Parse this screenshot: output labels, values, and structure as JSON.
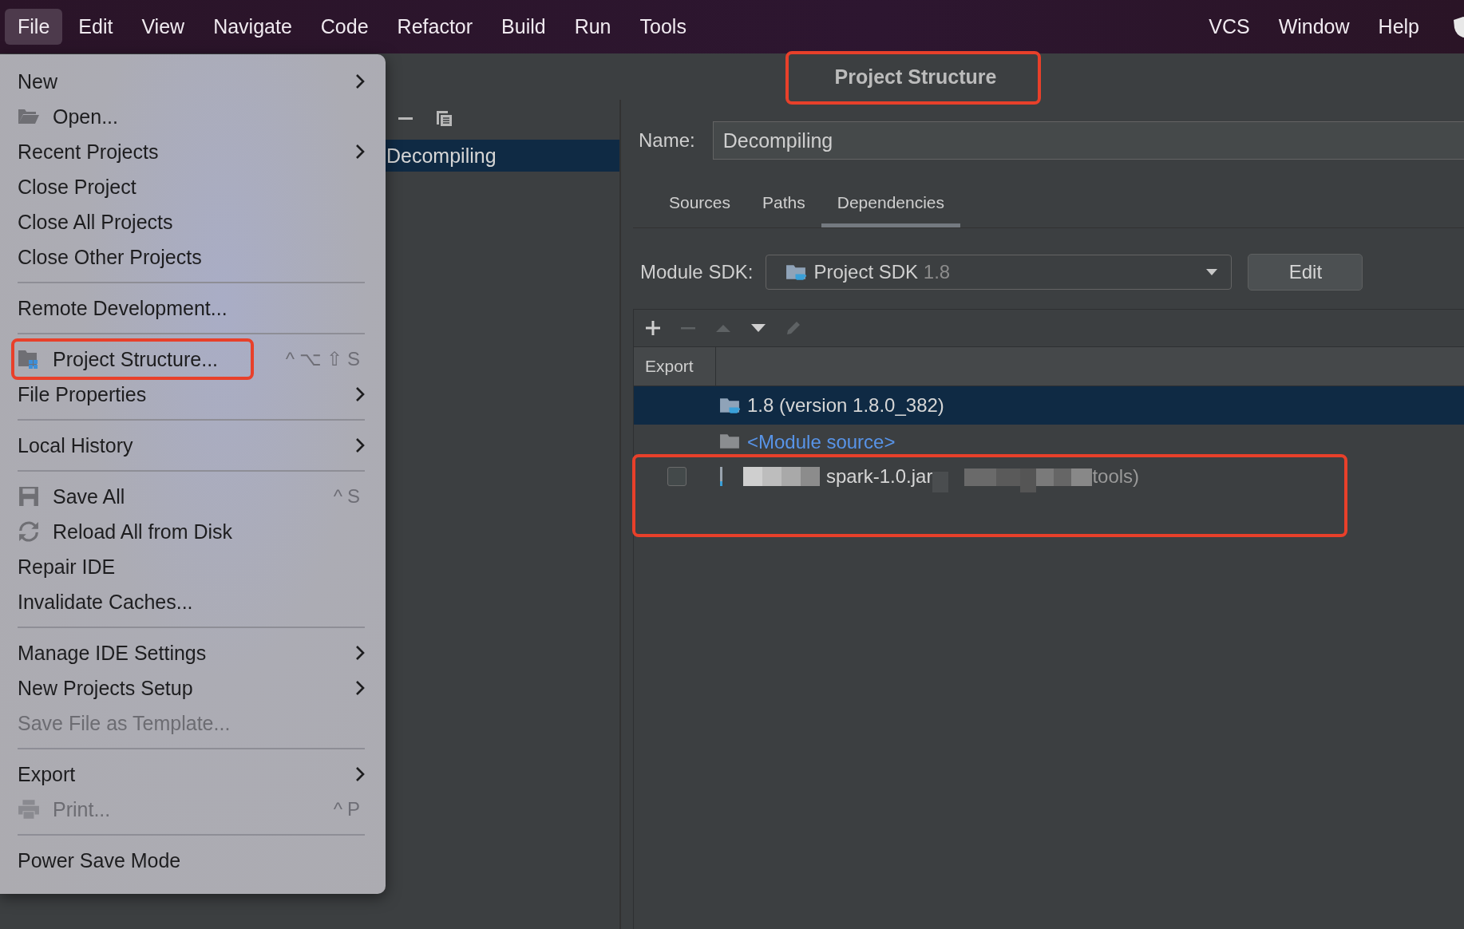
{
  "menu_bar": {
    "items": [
      {
        "label": "File",
        "selected": true
      },
      {
        "label": "Edit",
        "selected": false
      },
      {
        "label": "View",
        "selected": false
      },
      {
        "label": "Navigate",
        "selected": false
      },
      {
        "label": "Code",
        "selected": false
      },
      {
        "label": "Refactor",
        "selected": false
      },
      {
        "label": "Build",
        "selected": false
      },
      {
        "label": "Run",
        "selected": false
      },
      {
        "label": "Tools",
        "selected": false
      }
    ],
    "right_items": [
      {
        "label": "VCS",
        "selected": false
      },
      {
        "label": "Window",
        "selected": false
      },
      {
        "label": "Help",
        "selected": false
      }
    ]
  },
  "file_menu": {
    "items": [
      {
        "kind": "item",
        "label": "New",
        "submenu": true,
        "disabled": false
      },
      {
        "kind": "item",
        "label": "Open...",
        "icon": true,
        "disabled": false
      },
      {
        "kind": "item",
        "label": "Recent Projects",
        "submenu": true,
        "disabled": false
      },
      {
        "kind": "item",
        "label": "Close Project",
        "disabled": false
      },
      {
        "kind": "item",
        "label": "Close All Projects",
        "disabled": false
      },
      {
        "kind": "item",
        "label": "Close Other Projects",
        "disabled": false
      },
      {
        "kind": "separator"
      },
      {
        "kind": "item",
        "label": "Remote Development...",
        "disabled": false
      },
      {
        "kind": "separator"
      },
      {
        "kind": "item",
        "label": "Project Structure...",
        "icon": true,
        "shortcut": "^⌥⇧S",
        "disabled": false,
        "annotated": true
      },
      {
        "kind": "item",
        "label": "File Properties",
        "submenu": true,
        "disabled": false
      },
      {
        "kind": "separator"
      },
      {
        "kind": "item",
        "label": "Local History",
        "submenu": true,
        "disabled": false
      },
      {
        "kind": "separator"
      },
      {
        "kind": "item",
        "label": "Save All",
        "icon": true,
        "shortcut": "^S",
        "disabled": false
      },
      {
        "kind": "item",
        "label": "Reload All from Disk",
        "icon": true,
        "disabled": false
      },
      {
        "kind": "item",
        "label": "Repair IDE",
        "disabled": false
      },
      {
        "kind": "item",
        "label": "Invalidate Caches...",
        "disabled": false
      },
      {
        "kind": "separator"
      },
      {
        "kind": "item",
        "label": "Manage IDE Settings",
        "submenu": true,
        "disabled": false
      },
      {
        "kind": "item",
        "label": "New Projects Setup",
        "submenu": true,
        "disabled": false
      },
      {
        "kind": "item",
        "label": "Save File as Template...",
        "disabled": true
      },
      {
        "kind": "separator"
      },
      {
        "kind": "item",
        "label": "Export",
        "submenu": true,
        "disabled": false
      },
      {
        "kind": "item",
        "label": "Print...",
        "icon": true,
        "shortcut": "^P",
        "disabled": true
      },
      {
        "kind": "separator"
      },
      {
        "kind": "item",
        "label": "Power Save Mode",
        "disabled": false
      }
    ]
  },
  "dialog": {
    "title": "Project Structure",
    "title_annotated": true,
    "modules": [
      {
        "label": "Decompiling",
        "selected": true
      }
    ],
    "name_label": "Name:",
    "name_value": "Decompiling",
    "tabs": [
      {
        "label": "Sources",
        "selected": false
      },
      {
        "label": "Paths",
        "selected": false
      },
      {
        "label": "Dependencies",
        "selected": true
      }
    ],
    "module_sdk_label": "Module SDK:",
    "module_sdk_value": "Project SDK",
    "module_sdk_version": "1.8",
    "edit_button": "Edit",
    "dependency_toolbar": [
      {
        "disabled": false
      },
      {
        "disabled": true
      },
      {
        "disabled": true
      },
      {
        "disabled": false
      },
      {
        "disabled": true
      }
    ],
    "table": {
      "columns": [
        "Export"
      ],
      "rows": [
        {
          "kind": "sdk",
          "text": "1.8 (version 1.8.0_382)",
          "selected": true
        },
        {
          "kind": "source",
          "text": "<Module source>",
          "selected": false
        },
        {
          "kind": "jar",
          "texts": [
            "spark-1.0.jar",
            "tools)"
          ],
          "checked": false,
          "selected": false,
          "annotated": true
        }
      ]
    }
  }
}
